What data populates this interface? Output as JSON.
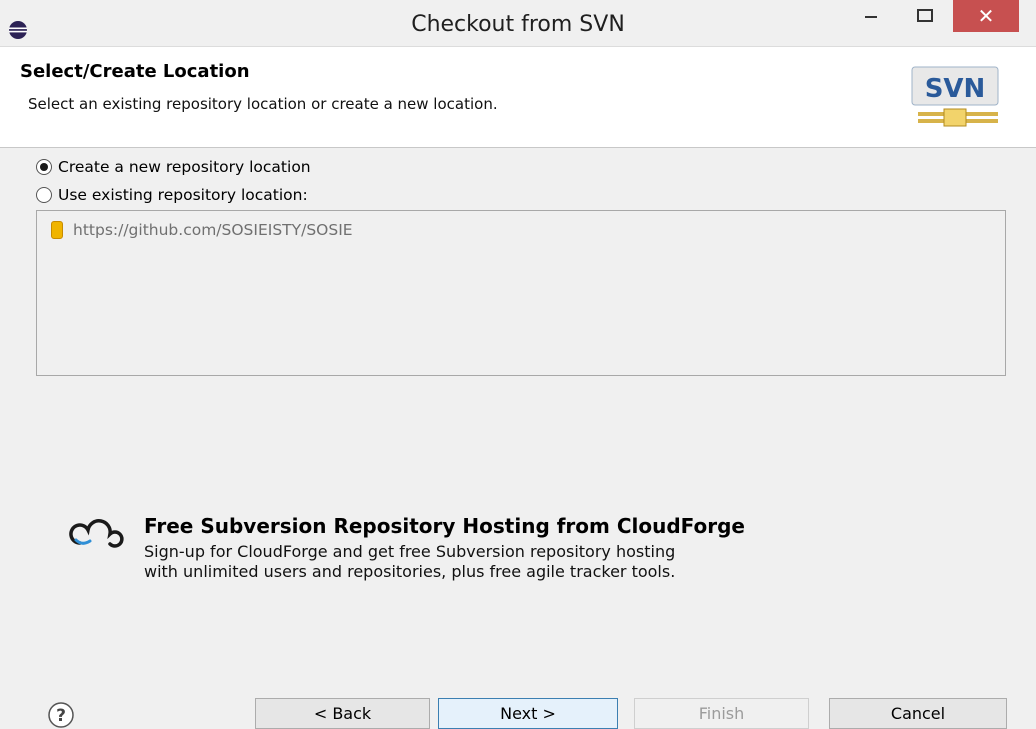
{
  "window": {
    "title": "Checkout from SVN",
    "min_symbol": "—",
    "max_symbol": "☐",
    "close_symbol": "✕"
  },
  "header": {
    "title": "Select/Create Location",
    "description": "Select an existing repository location or create a new location.",
    "logo_text": "SVN"
  },
  "options": {
    "create_new": {
      "label": "Create a new repository location",
      "selected": true
    },
    "use_existing": {
      "label": "Use existing repository location:",
      "selected": false
    }
  },
  "repositories": [
    {
      "url": "https://github.com/SOSIEISTY/SOSIE",
      "icon": "repository-icon"
    }
  ],
  "promo": {
    "title": "Free Subversion Repository Hosting from CloudForge",
    "line1": "Sign-up for CloudForge and get free Subversion repository hosting",
    "line2": "with unlimited users and repositories, plus free agile tracker tools."
  },
  "buttons": {
    "back": "< Back",
    "next": "Next >",
    "finish": "Finish",
    "cancel": "Cancel"
  },
  "colors": {
    "close_button": "#c75050",
    "next_button_border": "#3c7fb1",
    "repo_icon": "#f0b400"
  }
}
